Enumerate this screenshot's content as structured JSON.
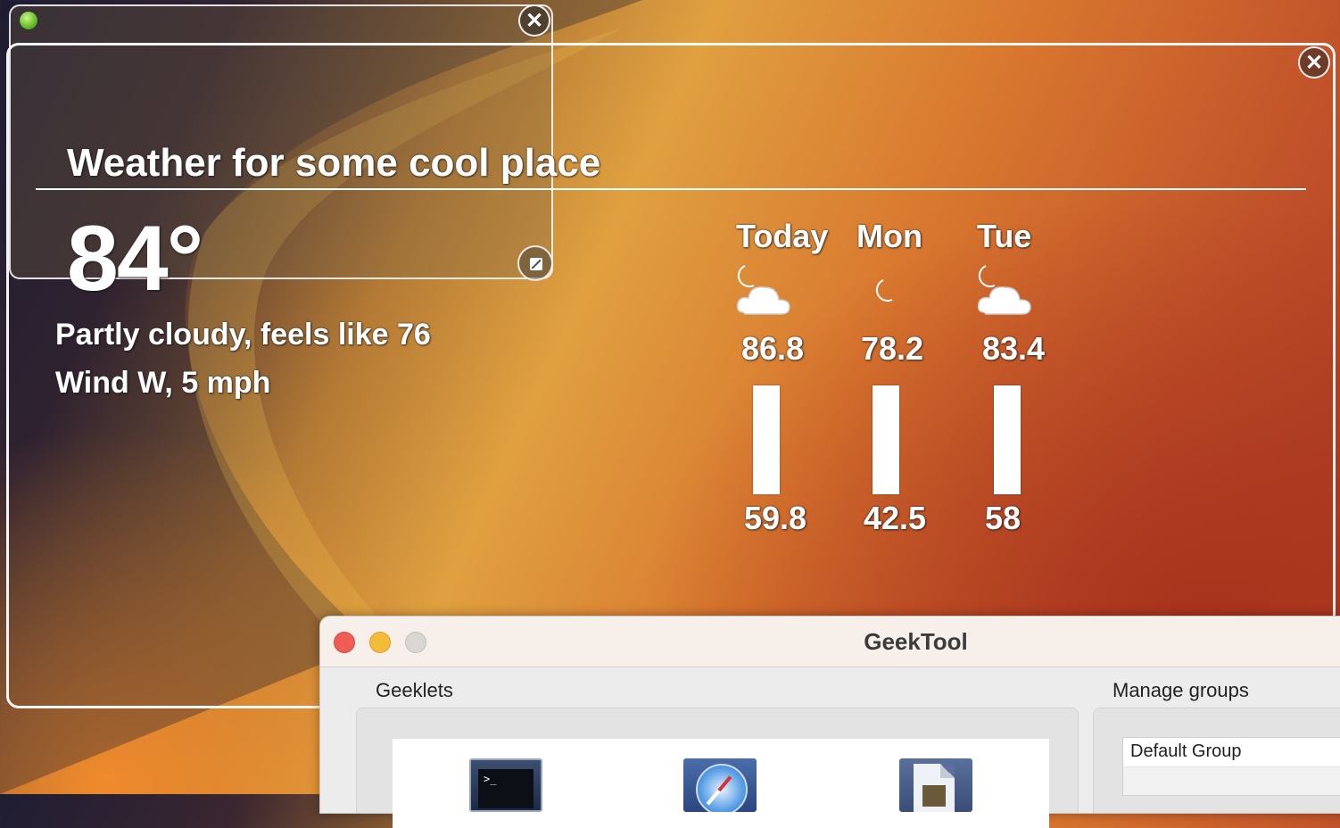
{
  "weather": {
    "title": "Weather for some cool place",
    "temperature": "84°",
    "conditions": "Partly cloudy, feels like 76",
    "wind": "Wind W, 5 mph",
    "forecast": [
      {
        "day": "Today",
        "icon": "partly-cloudy-night-icon",
        "high": "86.8",
        "low": "59.8"
      },
      {
        "day": "Mon",
        "icon": "clear-night-icon",
        "high": "78.2",
        "low": "42.5"
      },
      {
        "day": "Tue",
        "icon": "partly-cloudy-night-icon",
        "high": "83.4",
        "low": "58"
      }
    ]
  },
  "geektool": {
    "window_title": "GeekTool",
    "geeklets_label": "Geeklets",
    "manage_groups_label": "Manage groups",
    "geeklet_types": [
      {
        "icon": "shell-geeklet-icon"
      },
      {
        "icon": "web-geeklet-icon"
      },
      {
        "icon": "file-geeklet-icon"
      }
    ],
    "groups": [
      "Default Group"
    ]
  },
  "colors": {
    "close_red": "#ee5e56",
    "minimize_yellow": "#f4bb3b",
    "zoom_gray": "#d9d6d4",
    "status_green": "#6bc02c",
    "moon_blue": "#2f6fd6"
  }
}
